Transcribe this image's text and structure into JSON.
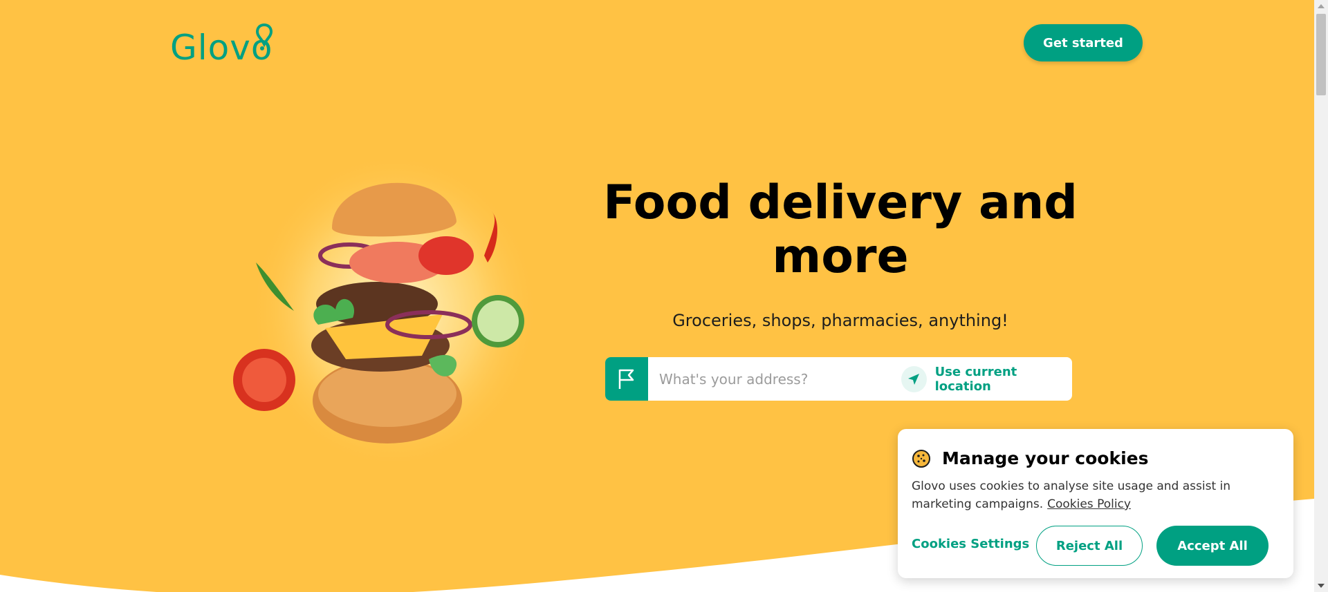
{
  "header": {
    "logo_text": "Glovo",
    "cta_label": "Get started"
  },
  "hero": {
    "title": "Food delivery and more",
    "subtitle": "Groceries, shops, pharmacies, anything!",
    "address_placeholder": "What's your address?",
    "address_value": "",
    "location_label": "Use current location"
  },
  "cookies": {
    "title": "Manage your cookies",
    "text": "Glovo uses cookies to analyse site usage and assist in marketing campaigns.",
    "policy_link": "Cookies Policy",
    "settings_label": "Cookies Settings",
    "reject_label": "Reject All",
    "accept_label": "Accept All"
  },
  "icons": {
    "logo_pin": "location-pin-icon",
    "flag": "flag-icon",
    "location": "navigation-arrow-icon",
    "cookie": "cookie-icon"
  },
  "colors": {
    "background": "#ffc244",
    "brand": "#00a082",
    "white": "#ffffff"
  }
}
